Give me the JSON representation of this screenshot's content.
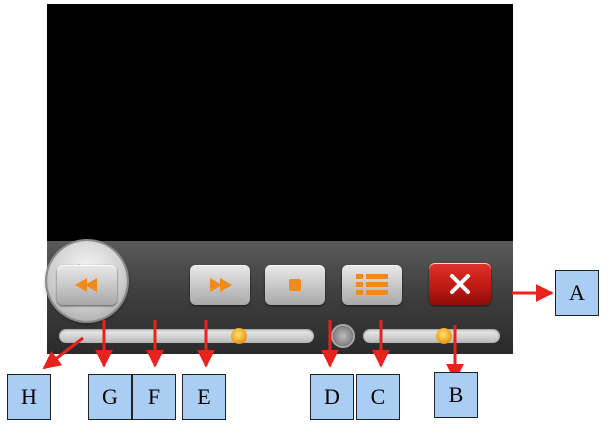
{
  "player": {
    "seek_position_fraction": 0.72,
    "volume_fraction": 0.6,
    "icons": [
      "rewind-icon",
      "play-icon",
      "forward-icon",
      "stop-icon",
      "playlist-icon",
      "close-icon",
      "volume-icon"
    ],
    "colors": {
      "accent_orange": "#f08a1c",
      "close_red": "#c81d16",
      "arrow_red": "#e8231d",
      "callout_blue": "#a9cdf3"
    }
  },
  "callouts": {
    "a": "A",
    "b": "B",
    "c": "C",
    "d": "D",
    "e": "E",
    "f": "F",
    "g": "G",
    "h": "H"
  }
}
